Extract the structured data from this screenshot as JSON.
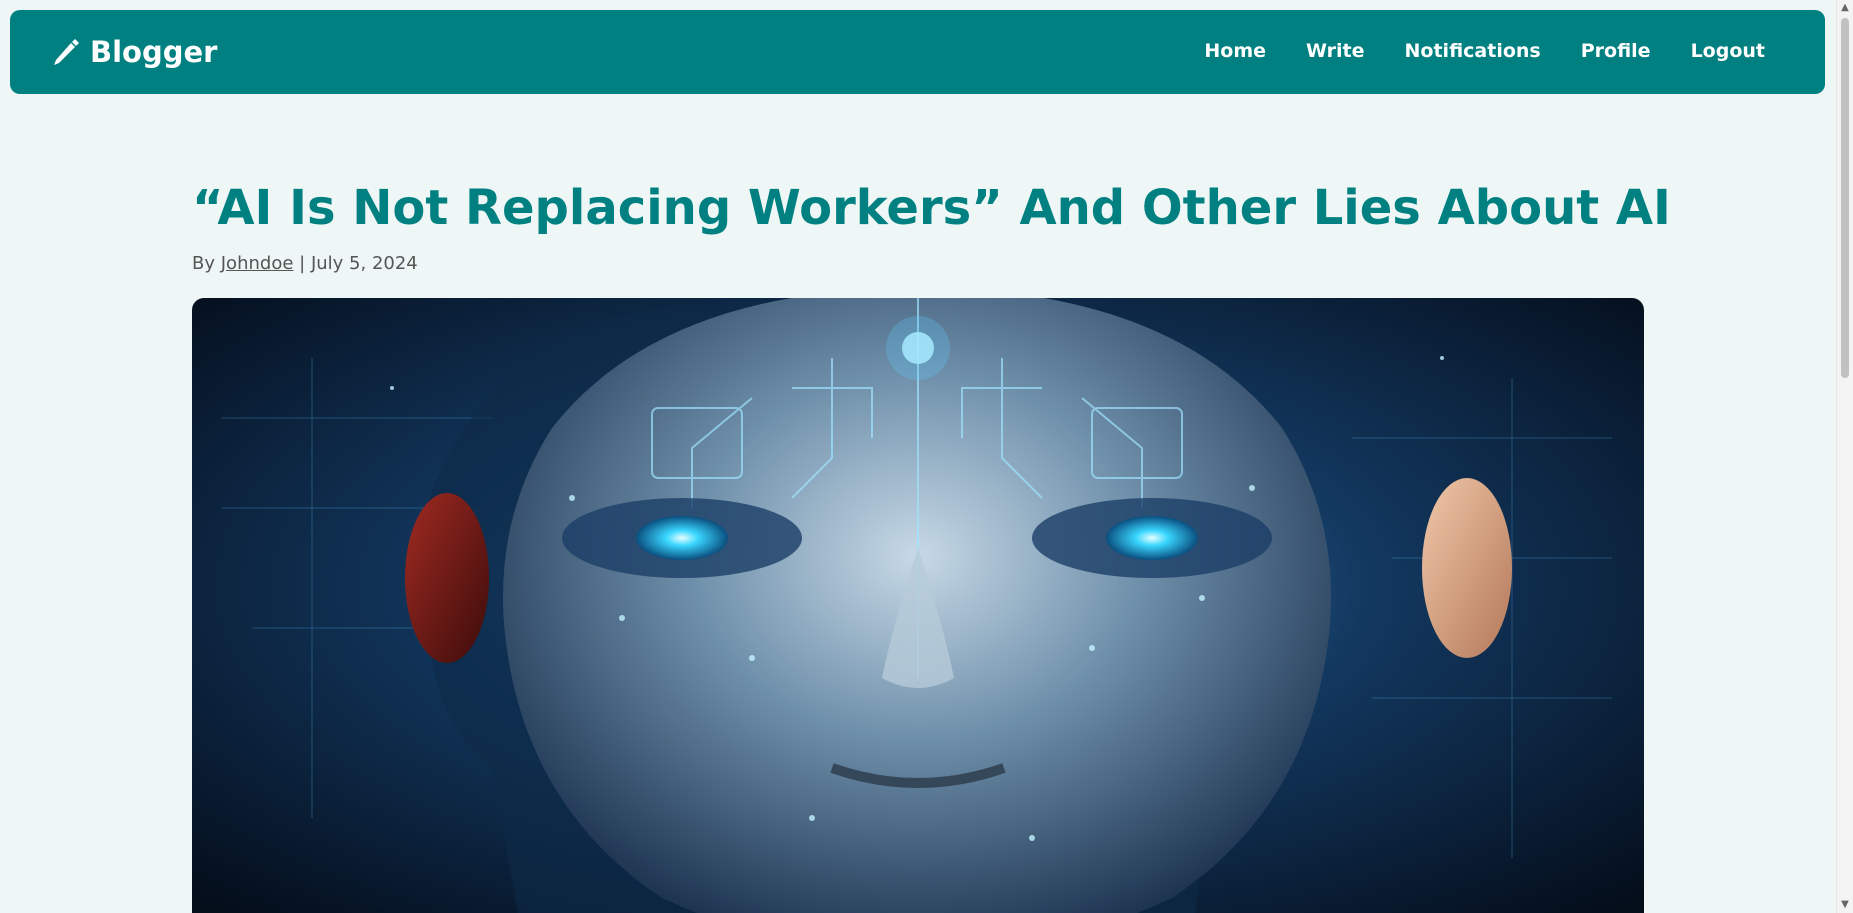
{
  "header": {
    "brand": "Blogger",
    "brand_icon": "pencil-icon",
    "nav": [
      "Home",
      "Write",
      "Notifications",
      "Profile",
      "Logout"
    ],
    "colors": {
      "bar": "#008080",
      "text": "#ffffff"
    }
  },
  "article": {
    "title": "“AI Is Not Replacing Workers” And Other Lies About AI",
    "by_label": "By",
    "author": "Johndoe",
    "separator": "|",
    "date": "July 5, 2024"
  },
  "hero_image": {
    "icon": "ai-face-image"
  },
  "colors": {
    "accent": "#008080",
    "page_bg": "#eef6f6",
    "muted_text": "#555555"
  }
}
